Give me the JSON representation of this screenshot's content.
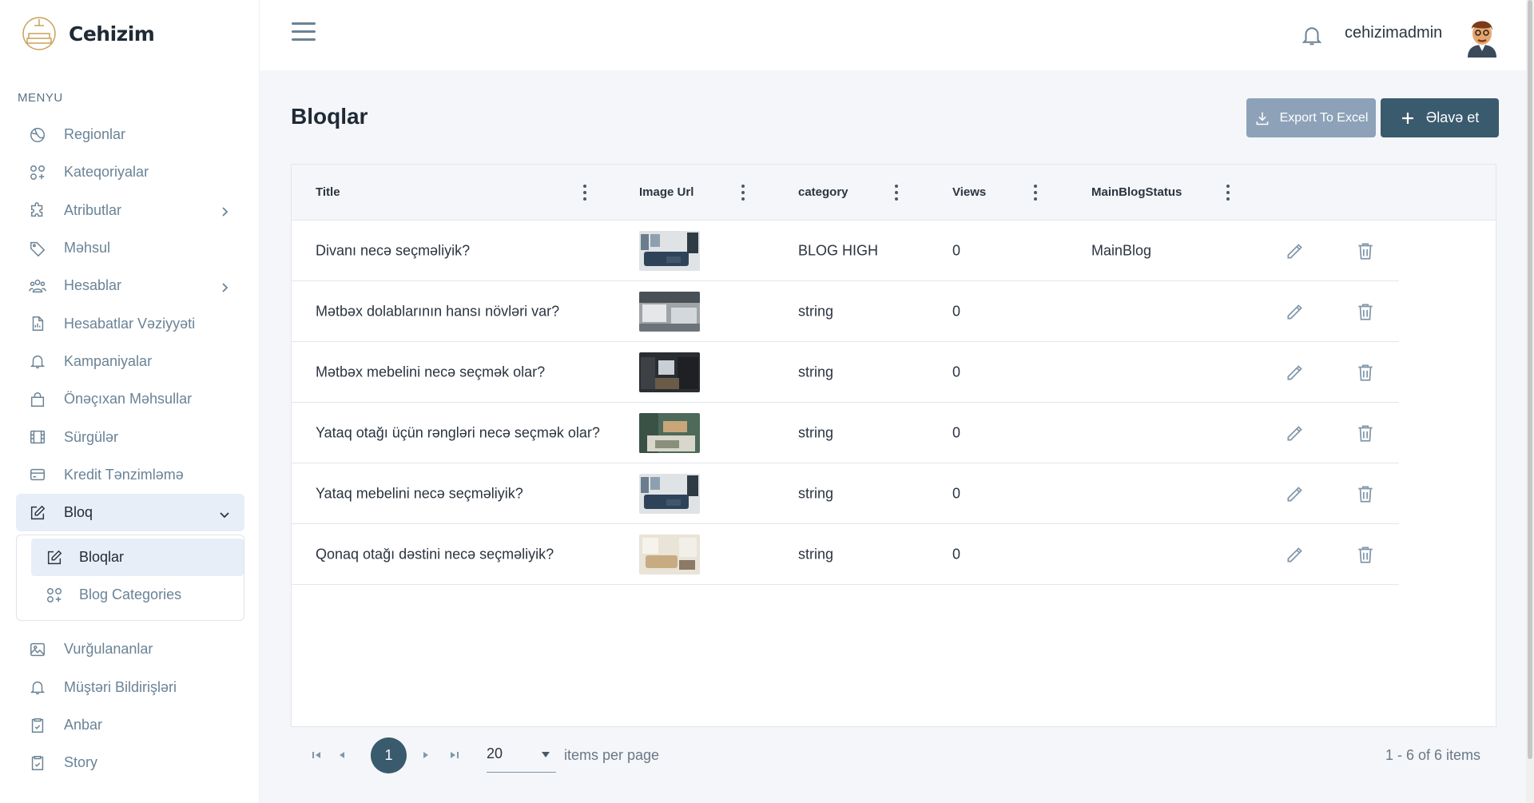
{
  "brand": {
    "name": "Cehizim"
  },
  "sidebar": {
    "caption": "MENYU",
    "items": [
      {
        "label": "Regionlar",
        "icon": "globe-icon"
      },
      {
        "label": "Kateqoriyalar",
        "icon": "categories-icon"
      },
      {
        "label": "Atributlar",
        "icon": "puzzle-icon",
        "has_children": true
      },
      {
        "label": "Məhsul",
        "icon": "tag-icon"
      },
      {
        "label": "Hesablar",
        "icon": "users-icon",
        "has_children": true
      },
      {
        "label": "Hesabatlar Vəziyyəti",
        "icon": "report-icon"
      },
      {
        "label": "Kampaniyalar",
        "icon": "bell-icon"
      },
      {
        "label": "Önəçıxan Məhsullar",
        "icon": "bag-icon"
      },
      {
        "label": "Sürgülər",
        "icon": "film-icon"
      },
      {
        "label": "Kredit Tənzimləmə",
        "icon": "credit-card-icon"
      },
      {
        "label": "Bloq",
        "icon": "edit-icon",
        "expanded": true
      }
    ],
    "bloq_children": [
      {
        "label": "Bloqlar",
        "icon": "edit-icon",
        "active": true
      },
      {
        "label": "Blog Categories",
        "icon": "categories-icon"
      }
    ],
    "items_after": [
      {
        "label": "Vurğulananlar",
        "icon": "image-icon"
      },
      {
        "label": "Müştəri Bildirişləri",
        "icon": "bell-icon"
      },
      {
        "label": "Anbar",
        "icon": "clipboard-check-icon"
      },
      {
        "label": "Story",
        "icon": "clipboard-check-icon"
      }
    ]
  },
  "header": {
    "username": "cehizimadmin"
  },
  "page": {
    "title": "Bloqlar",
    "export_label": "Export To Excel",
    "add_label": "Əlavə et"
  },
  "grid": {
    "columns": [
      "Title",
      "Image Url",
      "category",
      "Views",
      "MainBlogStatus"
    ],
    "rows": [
      {
        "title": "Divanı necə seçməliyik?",
        "category": "BLOG HIGH",
        "views": "0",
        "status": "MainBlog"
      },
      {
        "title": "Mətbəx dolablarının hansı növləri var?",
        "category": "string",
        "views": "0",
        "status": ""
      },
      {
        "title": "Mətbəx mebelini necə seçmək olar?",
        "category": "string",
        "views": "0",
        "status": ""
      },
      {
        "title": "Yataq otağı üçün rəngləri necə seçmək olar?",
        "category": "string",
        "views": "0",
        "status": ""
      },
      {
        "title": "Yataq mebelini necə seçməliyik?",
        "category": "string",
        "views": "0",
        "status": ""
      },
      {
        "title": "Qonaq otağı dəstini necə seçməliyik?",
        "category": "string",
        "views": "0",
        "status": ""
      }
    ]
  },
  "pager": {
    "current_page": "1",
    "page_size": "20",
    "page_size_label": "items per page",
    "info": "1 - 6 of 6 items"
  },
  "colors": {
    "primary": "#3a5a6e",
    "export": "#8da2b8",
    "active_bg": "#e8eef8"
  }
}
